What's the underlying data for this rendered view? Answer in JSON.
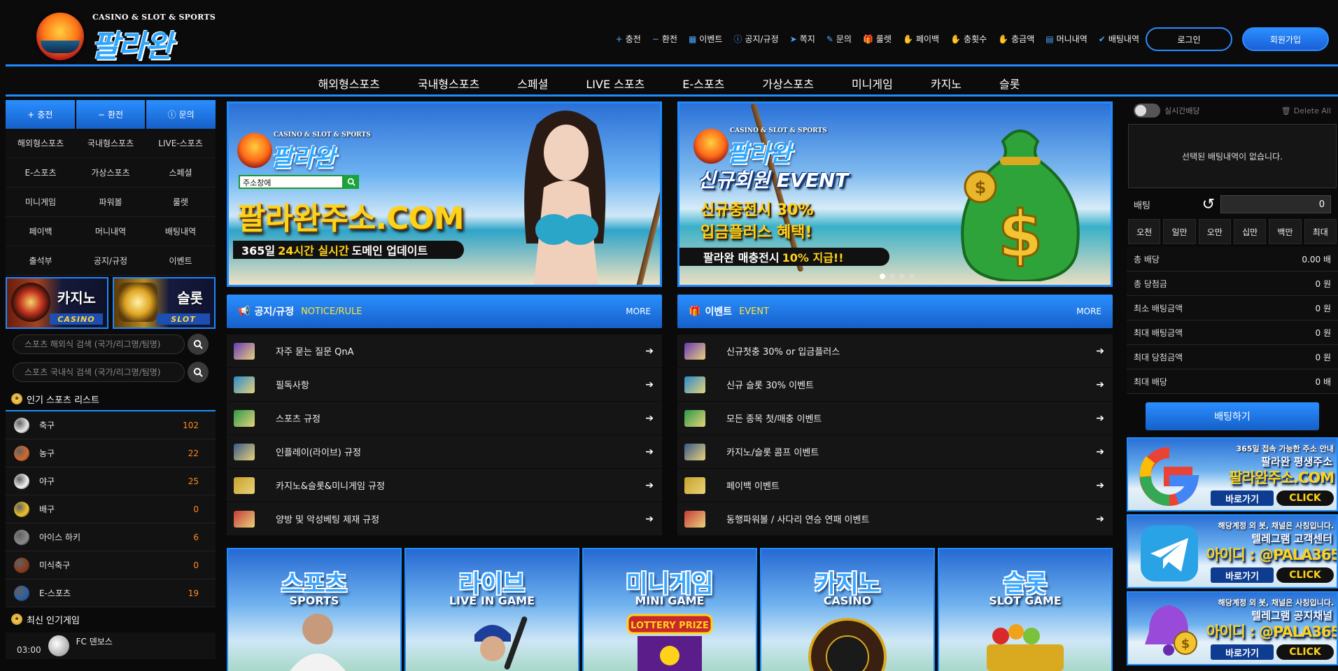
{
  "brand": {
    "tagline": "CASINO & SLOT & SPORTS",
    "name": "팔라완"
  },
  "topnav": [
    {
      "label": "충전",
      "icon": "plus-icon"
    },
    {
      "label": "환전",
      "icon": "minus-icon"
    },
    {
      "label": "이벤트",
      "icon": "calendar-icon"
    },
    {
      "label": "공지/규정",
      "icon": "info-icon"
    },
    {
      "label": "쪽지",
      "icon": "paper-plane-icon"
    },
    {
      "label": "문의",
      "icon": "edit-icon"
    },
    {
      "label": "룰렛",
      "icon": "gift-icon"
    },
    {
      "label": "페이백",
      "icon": "hand-coin-icon"
    },
    {
      "label": "충횟수",
      "icon": "hand-coin-icon"
    },
    {
      "label": "충금액",
      "icon": "hand-coin-icon"
    },
    {
      "label": "머니내역",
      "icon": "document-icon"
    },
    {
      "label": "배팅내역",
      "icon": "check-icon"
    }
  ],
  "auth": {
    "login": "로그인",
    "join": "회원가입"
  },
  "mainnav": [
    "해외형스포츠",
    "국내형스포츠",
    "스페셜",
    "LIVE 스포츠",
    "E-스포츠",
    "가상스포츠",
    "미니게임",
    "카지노",
    "슬롯"
  ],
  "left": {
    "quick": [
      {
        "label": "충전",
        "icon": "plus-icon",
        "glyph": "+"
      },
      {
        "label": "환전",
        "icon": "minus-icon",
        "glyph": "−"
      },
      {
        "label": "문의",
        "icon": "info-icon",
        "glyph": "ⓘ"
      }
    ],
    "menu": [
      "해외형스포츠",
      "국내형스포츠",
      "LIVE-스포츠",
      "E-스포츠",
      "가상스포츠",
      "스페셜",
      "미니게임",
      "파워볼",
      "룰렛",
      "페이백",
      "머니내역",
      "배팅내역",
      "출석부",
      "공지/규정",
      "이벤트"
    ],
    "cards": [
      {
        "title": "카지노",
        "sub": "CASINO"
      },
      {
        "title": "슬롯",
        "sub": "SLOT"
      }
    ],
    "search_overseas_placeholder": "스포츠 해외식 검색 (국가/리그명/팀명)",
    "search_domestic_placeholder": "스포츠 국내식 검색 (국가/리그명/팀명)",
    "popular_title": "인기 스포츠 리스트",
    "sports": [
      {
        "name": "축구",
        "count": "102",
        "color": "#e8e8e8"
      },
      {
        "name": "농구",
        "count": "22",
        "color": "#d9682a"
      },
      {
        "name": "야구",
        "count": "25",
        "color": "#f2f2f2"
      },
      {
        "name": "배구",
        "count": "0",
        "color": "#f0c32a"
      },
      {
        "name": "아이스 하키",
        "count": "6",
        "color": "#8a8a8a"
      },
      {
        "name": "미식축구",
        "count": "0",
        "color": "#8a3a1a"
      },
      {
        "name": "E-스포츠",
        "count": "19",
        "color": "#2a5fa8"
      }
    ],
    "recent_title": "최신 인기게임",
    "recent_game": {
      "time": "03:00",
      "team": "FC 덴보스"
    }
  },
  "banners": {
    "b1": {
      "tagline": "CASINO & SLOT & SPORTS",
      "name": "팔라완",
      "search_value": "주소창에",
      "domain": "팔라완주소.COM",
      "strip_a": "365일",
      "strip_b": "24시간 실시간",
      "strip_c": "도메인 업데이트"
    },
    "b2": {
      "tagline": "CASINO & SLOT & SPORTS",
      "name": "팔라완",
      "title": "신규회원 EVENT",
      "sub1": "신규충전시 30%",
      "sub2": "입금플러스 혜택!",
      "strip_a": "팔라완 매충전시",
      "strip_b": "10% 지급!!"
    }
  },
  "notice": {
    "title": "공지/규정",
    "en": "NOTICE/RULE",
    "more": "MORE",
    "items": [
      "자주 묻는 질문 QnA",
      "필독사항",
      "스포츠 규정",
      "인플레이(라이브) 규정",
      "카지노&슬롯&미니게임 규정",
      "양방 및 악성베팅 제재 규정"
    ]
  },
  "event": {
    "title": "이벤트",
    "en": "EVENT",
    "more": "MORE",
    "items": [
      "신규첫충 30% or 입금플러스",
      "신규 슬롯 30% 이벤트",
      "모든 종목 첫/매충 이벤트",
      "카지노/슬롯 콤프 이벤트",
      "페이백 이벤트",
      "동행파워볼 / 사다리 연승 연패 이벤트"
    ]
  },
  "tiles": [
    {
      "title": "스포츠",
      "sub": "SPORTS"
    },
    {
      "title": "라이브",
      "sub": "LIVE IN GAME"
    },
    {
      "title": "미니게임",
      "sub": "MINI GAME"
    },
    {
      "title": "카지노",
      "sub": "CASINO"
    },
    {
      "title": "슬롯",
      "sub": "SLOT GAME"
    }
  ],
  "betslip": {
    "realtime_label": "실시간배당",
    "delete_all": "Delete All",
    "empty": "선택된 배팅내역이 없습니다.",
    "bet_label": "배팅",
    "bet_value": "0",
    "chips": [
      "오천",
      "일만",
      "오만",
      "십만",
      "백만",
      "최대"
    ],
    "stats": [
      {
        "label": "총 배당",
        "value": "0.00 배"
      },
      {
        "label": "총 당첨금",
        "value": "0 원"
      },
      {
        "label": "최소 배팅금액",
        "value": "0 원"
      },
      {
        "label": "최대 배팅금액",
        "value": "0 원"
      },
      {
        "label": "최대 당첨금액",
        "value": "0 원"
      },
      {
        "label": "최대 배당",
        "value": "0 배"
      }
    ],
    "submit": "배팅하기"
  },
  "promos": [
    {
      "line1": "365일 접속 가능한 주소 안내",
      "line2": "팔라완 평생주소",
      "line3": "팔라완주소.COM",
      "go": "바로가기",
      "click": "CLICK"
    },
    {
      "line1": "해당계정 외 봇, 채널은 사칭입니다.",
      "line2": "텔레그램 고객센터",
      "line3": "아이디 : @PALA365",
      "go": "바로가기",
      "click": "CLICK"
    },
    {
      "line1": "해당계정 외 봇, 채널은 사칭입니다.",
      "line2": "텔레그램 공지채널",
      "line3": "아이디 : @PALA365",
      "go": "바로가기",
      "click": "CLICK"
    }
  ]
}
